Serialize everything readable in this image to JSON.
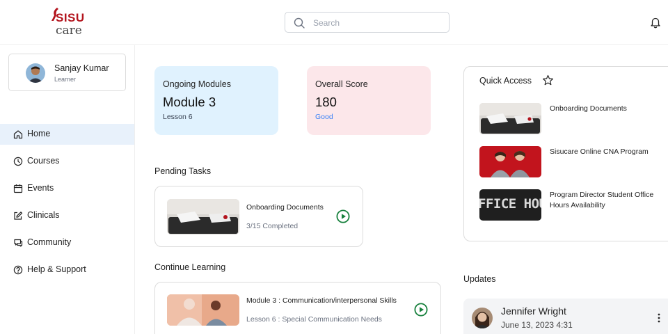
{
  "brand": {
    "line1": "SISU",
    "line2": "care",
    "accent": "#b3141d"
  },
  "search": {
    "placeholder": "Search",
    "value": ""
  },
  "profile": {
    "name": "Sanjay Kumar",
    "role": "Learner"
  },
  "nav": {
    "items": [
      {
        "label": "Home",
        "icon": "home-icon",
        "active": true
      },
      {
        "label": "Courses",
        "icon": "clock-icon"
      },
      {
        "label": "Events",
        "icon": "calendar-icon"
      },
      {
        "label": "Clinicals",
        "icon": "edit-icon"
      },
      {
        "label": "Community",
        "icon": "chat-icon"
      },
      {
        "label": "Help & Support",
        "icon": "help-icon"
      }
    ]
  },
  "stats": {
    "ongoing": {
      "title": "Ongoing Modules",
      "value": "Module 3",
      "sub": "Lesson 6"
    },
    "score": {
      "title": "Overall Score",
      "value": "180",
      "sub": "Good"
    }
  },
  "pending": {
    "title": "Pending Tasks",
    "task": {
      "title": "Onboarding Documents",
      "sub": "3/15 Completed"
    }
  },
  "continue": {
    "title": "Continue Learning",
    "item": {
      "title": "Module 3 : Communication/interpersonal Skills",
      "sub": "Lesson 6 : Special Communication Needs"
    }
  },
  "quick_access": {
    "title": "Quick Access",
    "items": [
      {
        "label": "Onboarding Documents"
      },
      {
        "label": "Sisucare Online CNA Program"
      },
      {
        "label": "Program Director Student Office Hours Availability",
        "thumb_text": "FFICE HOU"
      }
    ]
  },
  "updates": {
    "title": "Updates",
    "item": {
      "name": "Jennifer Wright",
      "date": "June 13, 2023 4:31"
    }
  },
  "colors": {
    "play": "#16803c",
    "active_nav": "#e8f1fb",
    "ongoing_bg": "#e0f2fe",
    "score_bg": "#fce7ea",
    "good": "#3b82f6"
  }
}
